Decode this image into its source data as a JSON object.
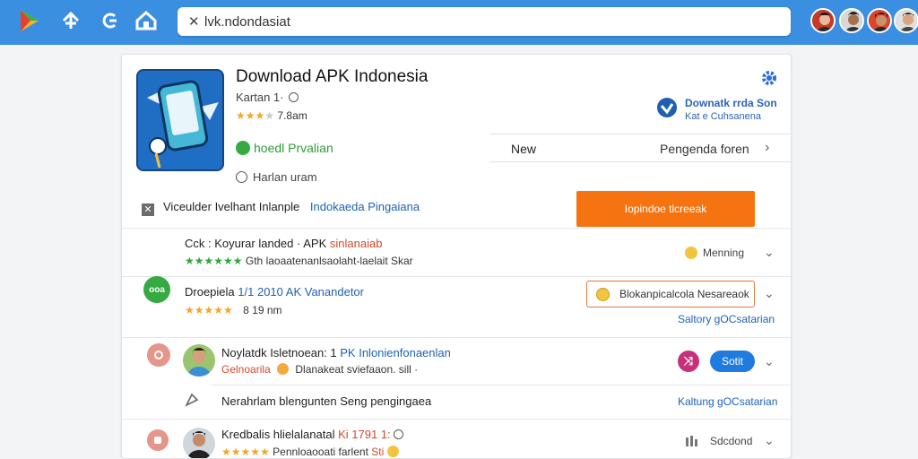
{
  "topbar": {
    "search_value": "lvk.ndondasiat",
    "nav_icons": [
      "play-logo-icon",
      "plus-share-icon",
      "back-icon",
      "home-icon"
    ],
    "accent_color": "#3b8fe0"
  },
  "app": {
    "title": "Download APK Indonesia",
    "subtitle": "Kartan 1·",
    "rating_text": "7.8am",
    "promo_line1": "Downatk  rrda  Son",
    "promo_line2": "Kat  e  Cuhsanena",
    "green_label": "hoedl  Prvalian",
    "clock_text": "Harlan uram",
    "checkbox_text": "Viceulder Ivelhant  Inlanple",
    "checkbox_link": "Indokaeda Pingaiana",
    "install_button": "Iopindoe tlcreeak"
  },
  "tabs": {
    "new": "New",
    "pengenda": "Pengenda foren"
  },
  "rows": [
    {
      "title_main": "Cck : Koyurar landed · APK",
      "title_red": "sinlanaiab",
      "sub": "Gth laoaatenanlsaolaht-laelait  Skar",
      "right_label": "Menning"
    },
    {
      "badge": "ooa",
      "title_main": "Droepiela",
      "title_blue": "1/1 2010  AK  Vanandetor",
      "rating_text": "8 19 nm",
      "button_text": "Blokanpicalcola  Nesareaok",
      "right_link": "Saltory gOCsatarian"
    },
    {
      "title_main": "Noylatdk Isletnoean:  1",
      "title_blue": "PK  Inlonienfonaenlan",
      "sub_red": "Gelnoarila",
      "sub": "Dlanakeat sviefaaon.  sill  ·",
      "pill_text": "Sotit"
    },
    {
      "text": "Nerahrlam blengunten Seng pengingaea",
      "right_link": "Kaltung gOCsatarian"
    },
    {
      "title_main": "Kredbalis hlielalanatal",
      "title_red": "Ki 1791 1:",
      "sub": "Pennloaooati",
      "sub2": "farlent",
      "sub_red": "Sti",
      "right_label": "Sdcdond"
    }
  ]
}
